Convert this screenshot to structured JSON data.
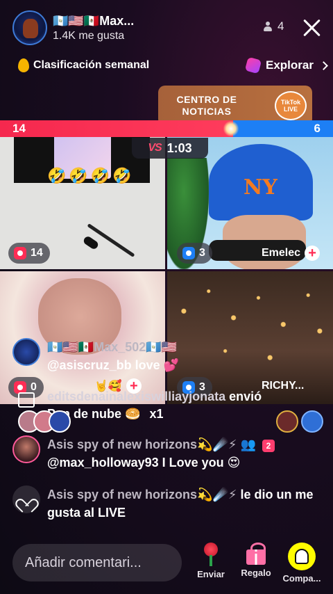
{
  "header": {
    "host_name": "🇬🇹🇺🇸🇲🇽Max...",
    "likes": "1.4K me gusta",
    "viewer_count": "4",
    "ranking_label": "Clasificación semanal",
    "explore_label": "Explorar"
  },
  "news_card": {
    "title_line1": "CENTRO DE",
    "title_line2": "NOTICIAS",
    "badge_text": "TikTok LIVE"
  },
  "battle": {
    "score_left": "14",
    "score_right": "6",
    "timer": "1:03",
    "vs_label": "VS",
    "red_fraction": 0.7
  },
  "tiles": [
    {
      "count": "14",
      "name": ""
    },
    {
      "count": "3",
      "name": "Emelec"
    },
    {
      "count": "0",
      "name": ""
    },
    {
      "count": "3",
      "name": "RICHY..."
    }
  ],
  "tile3_emojis": "🤣🤣🤣🤣",
  "tile3_overlay_emojis": "🤘🥰",
  "chat": [
    {
      "user": "🇬🇹🇺🇸🇲🇽Max_502🇬🇹🇺🇸",
      "message": "@asiscruz_bb love 💕"
    },
    {
      "user": "Asis spy of new horizons💫☄️⚡",
      "badge": "2",
      "message": "@max_holloway93 I Love you 😍"
    },
    {
      "user": "Asis spy of new horizons💫☄️⚡",
      "message": "le dio un me gusta al LIVE"
    }
  ],
  "gift": {
    "sender_line": "editsdenainalexiswilliayjonata",
    "sent_label": "envió",
    "gift_name": "Pan de nube 🥯",
    "count": "x1"
  },
  "bottom": {
    "comment_placeholder": "Añadir comentari...",
    "send_label": "Enviar",
    "gift_label": "Regalo",
    "share_label": "Compa..."
  },
  "colors": {
    "red_team": "#f5284e",
    "blue_team": "#1d7ff5",
    "background": "#1a0c20"
  }
}
